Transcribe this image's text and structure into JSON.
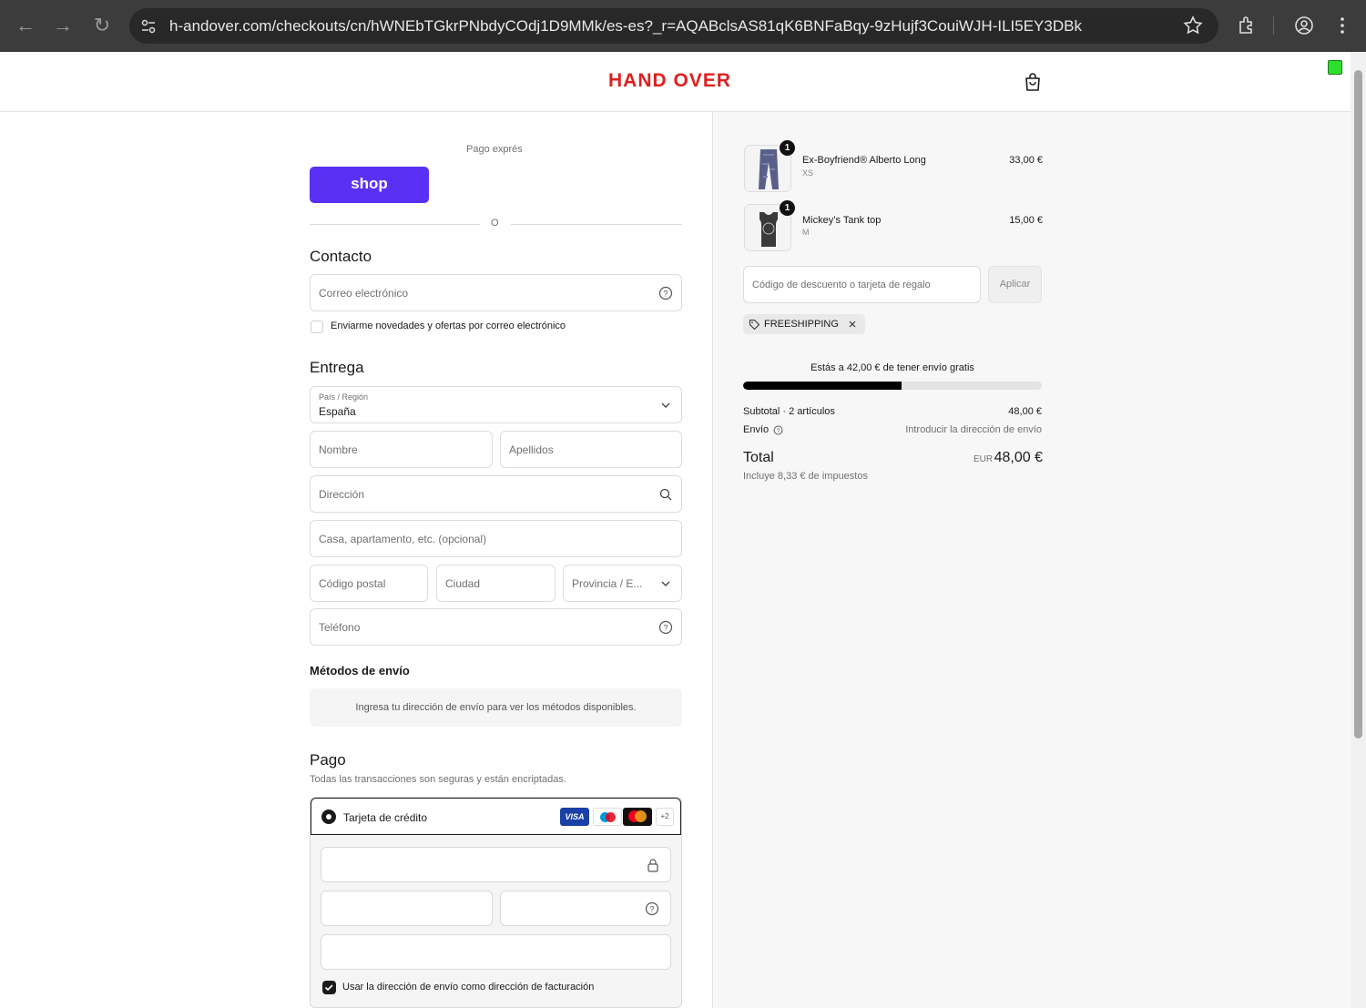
{
  "browser": {
    "url": "h-andover.com/checkouts/cn/hWNEbTGkrPNbdyCOdj1D9MMk/es-es?_r=AQABclsAS81qK6BNFaBqy-9zHujf3CouiWJH-ILI5EY3DBk"
  },
  "header": {
    "logo": "HAND OVER"
  },
  "express": {
    "title": "Pago exprés",
    "shop_label": "shop",
    "divider_text": "O"
  },
  "contact": {
    "title": "Contacto",
    "email_placeholder": "Correo electrónico",
    "newsletter_label": "Enviarme novedades y ofertas por correo electrónico"
  },
  "delivery": {
    "title": "Entrega",
    "country_label": "País / Región",
    "country_value": "España",
    "first_name": "Nombre",
    "last_name": "Apellidos",
    "address": "Dirección",
    "apartment": "Casa, apartamento, etc. (opcional)",
    "postal_code": "Código postal",
    "city": "Ciudad",
    "province": "Provincia / E...",
    "phone": "Teléfono"
  },
  "shipping": {
    "title": "Métodos de envío",
    "info": "Ingresa tu dirección de envío para ver los métodos disponibles."
  },
  "payment": {
    "title": "Pago",
    "subtitle": "Todas las transacciones son seguras y están encriptadas.",
    "method_label": "Tarjeta de crédito",
    "visa": "VISA",
    "more_cards": "+2",
    "billing_same": "Usar la dirección de envío como dirección de facturación"
  },
  "summary": {
    "items": [
      {
        "qty": "1",
        "name": "Ex-Boyfriend® Alberto Long",
        "variant": "XS",
        "price": "33,00 €"
      },
      {
        "qty": "1",
        "name": "Mickey’s Tank top",
        "variant": "M",
        "price": "15,00 €"
      }
    ],
    "discount_placeholder": "Código de descuento o tarjeta de regalo",
    "apply_label": "Aplicar",
    "applied_code": "FREESHIPPING",
    "free_shipping_msg": "Estás a 42,00 € de tener envío gratis",
    "free_shipping_progress": 0.53,
    "subtotal_label": "Subtotal · 2 artículos",
    "subtotal_value": "48,00 €",
    "shipping_label": "Envío",
    "shipping_value": "Introducir la dirección de envío",
    "total_label": "Total",
    "currency": "EUR",
    "total_value": "48,00 €",
    "tax_note": "Incluye 8,33 € de impuestos"
  }
}
